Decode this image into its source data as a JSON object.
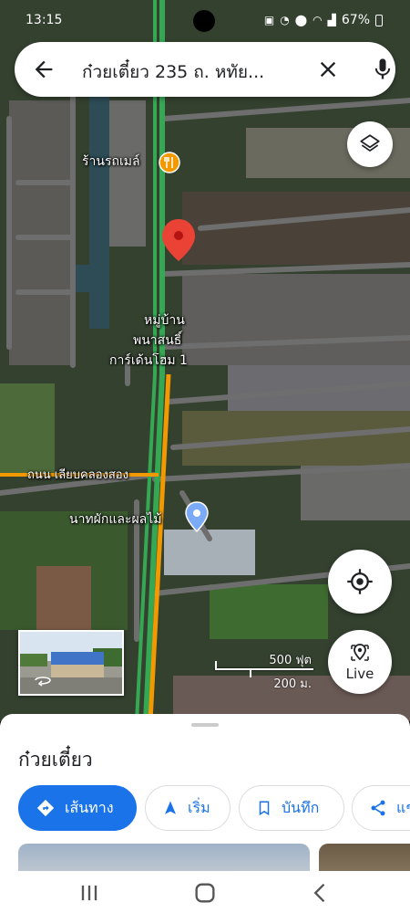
{
  "status_bar": {
    "time": "13:15",
    "battery": "67%"
  },
  "search": {
    "query": "ก๋วยเตี๋ยว 235 ถ. หทัย..."
  },
  "map": {
    "labels": {
      "shop": "ร้านรถเมล์",
      "village_line1": "หมู่บ้าน",
      "village_line2": "พนาสนธิ์",
      "village_line3": "การ์เด้นโฮม 1",
      "road": "ถนน เลียบคลองสอง",
      "market": "นาทผักและผลไม้"
    },
    "scale": {
      "imperial": "500 ฟุต",
      "metric": "200 ม."
    },
    "live_label": "Live",
    "colors": {
      "pin": "#ea4335",
      "traffic_green": "#34a853",
      "traffic_orange": "#f29900",
      "road_gray": "#6e6e6e"
    }
  },
  "sheet": {
    "title": "ก๋วยเตี๋ยว",
    "actions": {
      "directions": "เส้นทาง",
      "start": "เริ่ม",
      "save": "บันทึก",
      "share": "แช"
    },
    "accent": "#1a73e8"
  }
}
